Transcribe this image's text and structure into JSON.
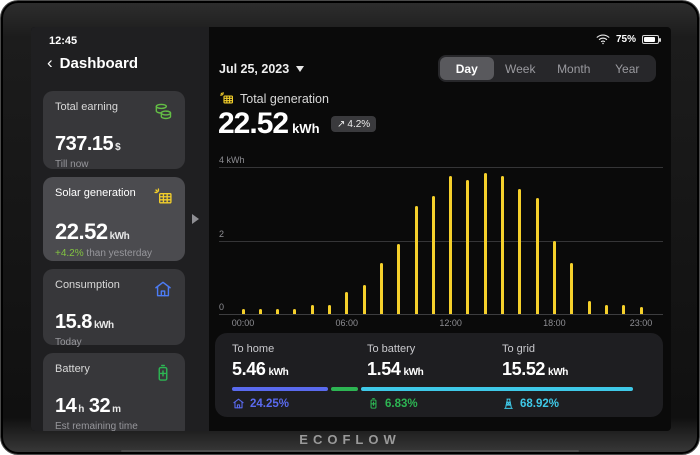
{
  "status_bar": {
    "time": "12:45",
    "battery_percent": "75%"
  },
  "sidebar": {
    "back_icon": "‹",
    "title": "Dashboard",
    "cards": [
      {
        "label": "Total earning",
        "value": "737.15",
        "unit": "$",
        "sub": "Till now",
        "icon": "coins-icon"
      },
      {
        "label": "Solar generation",
        "value": "22.52",
        "unit": "kWh",
        "delta": "+4.2%",
        "sub": "than yesterday",
        "icon": "solar-panel-icon"
      },
      {
        "label": "Consumption",
        "value": "15.8",
        "unit": "kWh",
        "sub": "Today",
        "icon": "home-icon"
      },
      {
        "label": "Battery",
        "value_h": "14",
        "unit_h": "h",
        "value_m": "32",
        "unit_m": "m",
        "sub": "Est remaining time",
        "icon": "battery-icon"
      }
    ]
  },
  "main": {
    "date_label": "Jul 25, 2023",
    "tabs": [
      {
        "label": "Day",
        "active": true
      },
      {
        "label": "Week",
        "active": false
      },
      {
        "label": "Month",
        "active": false
      },
      {
        "label": "Year",
        "active": false
      }
    ],
    "generation": {
      "label": "Total generation",
      "value": "22.52",
      "unit": "kWh",
      "delta_arrow": "↗",
      "delta": "4.2%"
    }
  },
  "chart_data": {
    "type": "bar",
    "title": "Total generation by hour",
    "x": [
      "00:00",
      "01:00",
      "02:00",
      "03:00",
      "04:00",
      "05:00",
      "06:00",
      "07:00",
      "08:00",
      "09:00",
      "10:00",
      "11:00",
      "12:00",
      "13:00",
      "14:00",
      "15:00",
      "16:00",
      "17:00",
      "18:00",
      "19:00",
      "20:00",
      "21:00",
      "22:00",
      "23:00"
    ],
    "values": [
      0.15,
      0.15,
      0.15,
      0.15,
      0.25,
      0.25,
      0.6,
      0.8,
      1.4,
      1.9,
      2.95,
      3.2,
      3.75,
      3.65,
      3.85,
      3.75,
      3.4,
      3.15,
      2.0,
      1.4,
      0.35,
      0.25,
      0.25,
      0.2
    ],
    "ylabel": "kWh",
    "ylim": [
      0,
      4
    ],
    "ytick_top": "4 kWh",
    "ytick_mid": "2",
    "ytick_base": "0",
    "xtick_labels": [
      "00:00",
      "06:00",
      "12:00",
      "18:00",
      "23:00"
    ],
    "bar_color": "#f5d02b",
    "grid": true,
    "legend": null
  },
  "distribution": {
    "items": [
      {
        "label": "To home",
        "value": "5.46",
        "unit": "kWh",
        "percent": "24.25%",
        "color": "#5a6aee",
        "icon": "home-icon"
      },
      {
        "label": "To battery",
        "value": "1.54",
        "unit": "kWh",
        "percent": "6.83%",
        "color": "#2db553",
        "icon": "battery-icon"
      },
      {
        "label": "To grid",
        "value": "15.52",
        "unit": "kWh",
        "percent": "68.92%",
        "color": "#3fc9e8",
        "icon": "grid-tower-icon"
      }
    ]
  },
  "brand": {
    "logo": "ECOFLOW"
  },
  "colors": {
    "accent_yellow": "#f5d02b",
    "accent_green": "#82c341",
    "accent_blue": "#4c7cf5",
    "accent_cyan": "#3fc9e8"
  }
}
